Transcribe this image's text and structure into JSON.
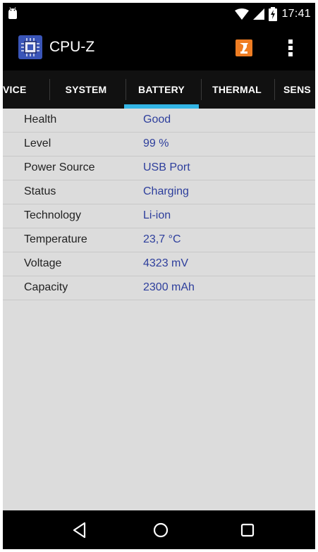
{
  "status_bar": {
    "time": "17:41",
    "icons": [
      "android-debug-icon",
      "wifi-icon",
      "signal-icon",
      "battery-charging-icon"
    ]
  },
  "toolbar": {
    "title": "CPU-Z",
    "icons": [
      "cpu-z-logo-icon",
      "test-tube-icon",
      "more-options-icon"
    ]
  },
  "tabs": [
    {
      "label": "VICE"
    },
    {
      "label": "SYSTEM"
    },
    {
      "label": "BATTERY",
      "active": true
    },
    {
      "label": "THERMAL"
    },
    {
      "label": "SENS"
    }
  ],
  "battery": [
    {
      "label": "Health",
      "value": "Good"
    },
    {
      "label": "Level",
      "value": "99 %"
    },
    {
      "label": "Power Source",
      "value": "USB Port"
    },
    {
      "label": "Status",
      "value": "Charging"
    },
    {
      "label": "Technology",
      "value": "Li-ion"
    },
    {
      "label": "Temperature",
      "value": "23,7 °C"
    },
    {
      "label": "Voltage",
      "value": "4323 mV"
    },
    {
      "label": "Capacity",
      "value": "2300 mAh"
    }
  ],
  "navigation": {
    "buttons": [
      "back-icon",
      "home-icon",
      "recents-icon"
    ]
  },
  "colors": {
    "tab_indicator": "#33b5e5",
    "value_text": "#2d3e9c",
    "content_bg": "#dcdcdc",
    "action_icon": "#ef7d23"
  }
}
